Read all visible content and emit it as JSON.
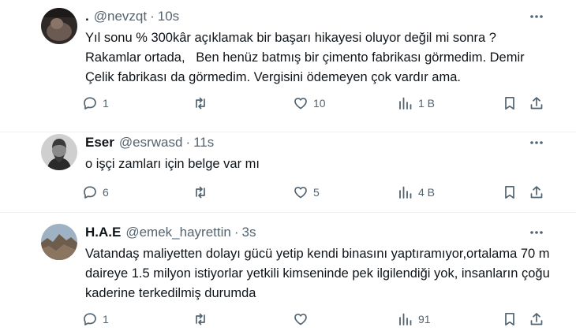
{
  "tweets": [
    {
      "name": ".",
      "handle": "@nevzqt",
      "separator": "·",
      "time": "10s",
      "avatar_color": "#4a3f3a",
      "text": "Yıl sonu % 300kâr açıklamak bir başarı hikayesi oluyor değil mi sonra ?\nRakamlar ortada,   Ben henüz batmış bir çimento fabrikası görmedim. Demir Çelik fabrikası da görmedim. Vergisini ödemeyen çok vardır ama.",
      "replies": "1",
      "retweets": "",
      "likes": "10",
      "views": "1 B"
    },
    {
      "name": "Eser",
      "handle": "@esrwasd",
      "separator": "·",
      "time": "11s",
      "avatar_color": "#3a3a3a",
      "text": "o işçi zamları için belge var mı",
      "replies": "6",
      "retweets": "",
      "likes": "5",
      "views": "4 B"
    },
    {
      "name": "H.A.E",
      "handle": "@emek_hayrettin",
      "separator": "·",
      "time": "3s",
      "avatar_color": "#7a6a58",
      "text": "Vatandaş maliyetten dolayı gücü yetip kendi binasını yaptıramıyor,ortalama 70 m daireye 1.5 milyon istiyorlar yetkili kimseninde pek ilgilendiği yok, insanların çoğu kaderine terkedilmiş durumda",
      "replies": "1",
      "retweets": "",
      "likes": "",
      "views": "91"
    }
  ],
  "icons": {
    "more": "more-icon",
    "reply": "reply-icon",
    "retweet": "retweet-icon",
    "like": "like-icon",
    "views": "views-icon",
    "bookmark": "bookmark-icon",
    "share": "share-icon"
  },
  "colors": {
    "text": "#0f1419",
    "secondary": "#536471",
    "divider": "#eff3f4"
  }
}
